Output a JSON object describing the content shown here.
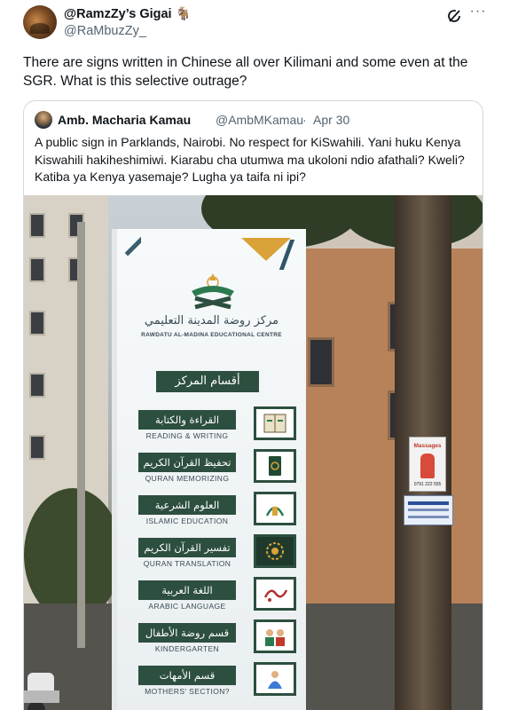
{
  "tweet": {
    "display_name": "@RamzZy’s Gigai 🐐",
    "handle": "@RaMbuzZy_",
    "text": "There are signs written in Chinese all over Kilimani and some even at the SGR. What is this selective outrage?",
    "icons": [
      "grok-icon",
      "more-icon"
    ]
  },
  "quote": {
    "display_name": "Amb. Macharia Kamau",
    "handle": "@AmbMKamau",
    "separator": "·",
    "date": "Apr 30",
    "text": "A public sign in Parklands, Nairobi. No respect for KiSwahili. Yani huku Kenya Kiswahili hakiheshimiwi. Kiarabu cha utumwa ma ukoloni ndio afathali? Kweli? Katiba ya Kenya yasemaje? Lugha ya taifa ni ipi?"
  },
  "sign": {
    "arabic_name": "مركز روضة المدينة التعليمي",
    "latin_name": "RAWDATU AL-MADINA EDUCATIONAL CENTRE",
    "header": "أقسام المركز",
    "departments": [
      {
        "ar": "القراءة والكتابة",
        "en": "READING & WRITING",
        "icon": "book-icon"
      },
      {
        "ar": "تحفيظ القرآن الكريم",
        "en": "QURAN MEMORIZING",
        "icon": "quran-icon"
      },
      {
        "ar": "العلوم الشرعية",
        "en": "ISLAMIC EDUCATION",
        "icon": "lantern-icon"
      },
      {
        "ar": "تفسير القرآن الكريم",
        "en": "QURAN TRANSLATION",
        "icon": "ornament-icon"
      },
      {
        "ar": "اللغة العربية",
        "en": "ARABIC LANGUAGE",
        "icon": "calligraphy-icon"
      },
      {
        "ar": "قسم روضة الأطفال",
        "en": "KINDERGARTEN",
        "icon": "children-icon"
      },
      {
        "ar": "قسم الأمهات",
        "en": "MOTHERS' SECTION?",
        "icon": "mother-icon"
      }
    ]
  },
  "poster": {
    "title": "Massages",
    "phone": "0791 222 555"
  }
}
